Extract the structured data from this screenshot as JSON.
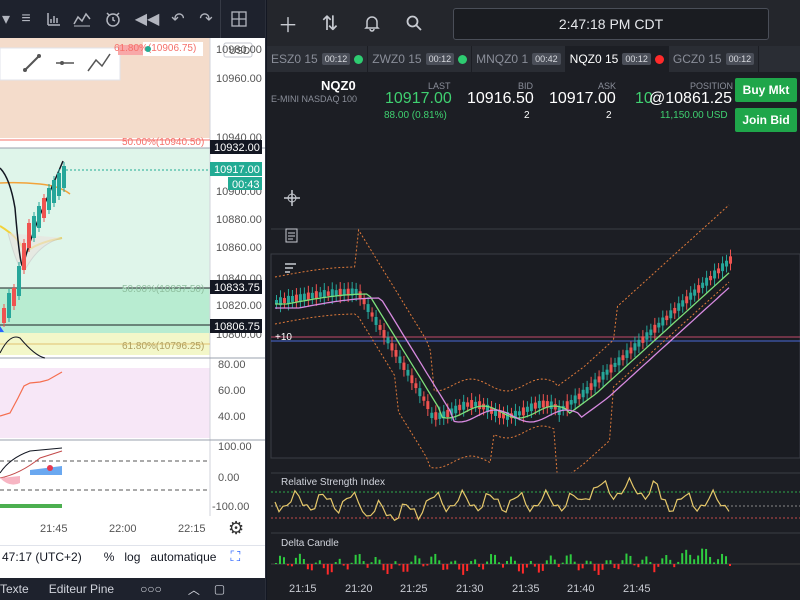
{
  "left": {
    "currency": "USD",
    "price_ticks": [
      "10980.00",
      "10960.00",
      "10940.00",
      "10900.00",
      "10880.00",
      "10860.00",
      "10840.00",
      "10820.00",
      "10800.00"
    ],
    "top_fib_label": "61.80%(10906.75)",
    "fib_50_top": "50.00%(10940.50)",
    "fib_50_mid": "50.00%(10837.50)",
    "fib_618_mid": "61.80%(10796.25)",
    "price_tag_10932": "10932.00",
    "price_tag_last": "10917.00",
    "price_tag_countdown": "00:43",
    "price_tag_10833": "10833.75",
    "price_tag_10806": "10806.75",
    "rsi_ticks": [
      "80.00",
      "60.00",
      "40.00"
    ],
    "osc_ticks": [
      "100.00",
      "0.00",
      "-100.00"
    ],
    "time_labels": [
      "21:45",
      "22:00",
      "22:15"
    ],
    "status_time": "47:17 (UTC+2)",
    "status_pct": "%",
    "status_log": "log",
    "status_auto": "automatique",
    "tab_text": "Texte",
    "tab_pine": "Editeur Pine"
  },
  "right": {
    "clock": "2:47:18 PM CDT",
    "tabs": [
      {
        "symbol": "ESZ0",
        "tf": "15",
        "timer": "00:12",
        "dot": "#2ecc71"
      },
      {
        "symbol": "ZWZ0",
        "tf": "15",
        "timer": "00:12",
        "dot": "#2ecc71"
      },
      {
        "symbol": "MNQZ0",
        "tf": "1",
        "timer": "00:42",
        "dot": ""
      },
      {
        "symbol": "NQZ0",
        "tf": "15",
        "timer": "00:12",
        "dot": "#ff2a2a"
      },
      {
        "symbol": "GCZ0",
        "tf": "15",
        "timer": "00:12",
        "dot": ""
      }
    ],
    "quote": {
      "symbol": "NQZ0",
      "name": "E-MINI NASDAQ 100",
      "last_label": "LAST",
      "last": "10917.00",
      "change": "88.00 (0.81%)",
      "bid_label": "BID",
      "bid": "10916.50",
      "bid_size": "2",
      "ask_label": "ASK",
      "ask": "10917.00",
      "ask_size": "2",
      "position_label": "POSITION",
      "position_qty": "10",
      "position": "@10861.25",
      "position_value": "11,150.00 USD",
      "buy_mkt": "Buy Mkt",
      "join_bid": "Join Bid"
    },
    "timeframe": "15s",
    "position_marker": "+10",
    "rsi_label": "Relative Strength Index",
    "delta_label": "Delta Candle",
    "time_labels": [
      "21:15",
      "21:20",
      "21:25",
      "21:30",
      "21:35",
      "21:40",
      "21:45"
    ]
  },
  "colors": {
    "up": "#26a69a",
    "down": "#ef5350",
    "green_btn": "#1fa64a",
    "accent_teal": "#22ab94"
  }
}
